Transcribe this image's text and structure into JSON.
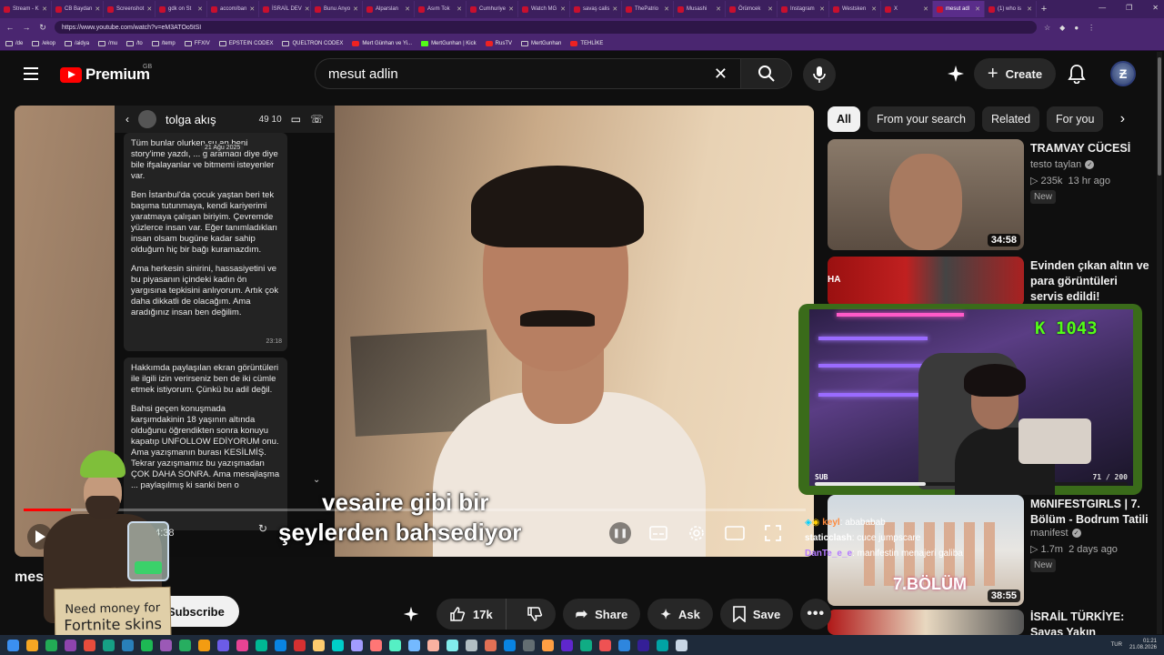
{
  "browser": {
    "tabs": [
      {
        "label": "Stream - K",
        "active": false
      },
      {
        "label": "CB Baydan",
        "active": false
      },
      {
        "label": "Screenshot",
        "active": false
      },
      {
        "label": "gdk on St",
        "active": false
      },
      {
        "label": "accom/ban",
        "active": false
      },
      {
        "label": "İSRAİL DEV",
        "active": false
      },
      {
        "label": "Bunu Anyo",
        "active": false
      },
      {
        "label": "Alparslan",
        "active": false
      },
      {
        "label": "Asım Tok",
        "active": false
      },
      {
        "label": "Cumhuriye",
        "active": false
      },
      {
        "label": "Watch MG",
        "active": false
      },
      {
        "label": "savaş calis",
        "active": false
      },
      {
        "label": "ThePatrio",
        "active": false
      },
      {
        "label": "Musashi",
        "active": false
      },
      {
        "label": "Örümcek",
        "active": false
      },
      {
        "label": "Instagram",
        "active": false
      },
      {
        "label": "Westsken",
        "active": false
      },
      {
        "label": "X",
        "active": false
      },
      {
        "label": "mesut adl",
        "active": true
      },
      {
        "label": "(1) who is",
        "active": false
      }
    ],
    "url": "https://www.youtube.com/watch?v=eM3ATOo5tSI",
    "bookmarks": [
      "/de",
      "/ekop",
      "/aidya",
      "/mu",
      "/to",
      "/temp",
      "FFXIV",
      "EPSTEIN CODEX",
      "QUELTRON CODEX",
      "Mert Günhan ve Yi...",
      "MertGunhan | Kick",
      "RusTV",
      "MertGunhan",
      "TEHLİKE"
    ]
  },
  "youtube": {
    "logo_text": "Premium",
    "region": "GB",
    "search_query": "mesut adlin",
    "create_label": "Create"
  },
  "video": {
    "chat_contact": "tolga akış",
    "chat_count": "49 10",
    "chat_date": "21 Ağu 2025",
    "bubble1": [
      "Tüm bunlar olurken şu an beni story'ime yazdı, ... g aramadı diye diye bile ifşalayanlar ve bitmemi isteyenler var.",
      "Ben İstanbul'da çocuk yaştan beri tek başıma tutunmaya, kendi kariyerimi yaratmaya çalışan biriyim. Çevremde yüzlerce insan var. Eğer tanımladıkları insan olsam bugüne kadar sahip olduğum hiç bir bağı kuramazdım.",
      "Ama herkesin sinirini, hassasiyetini ve bu piyasanın içindeki kadın ön yargısına tepkisini anlıyorum. Artık çok daha dikkatli de olacağım. Ama aradığınız insan ben değilim."
    ],
    "bubble1_time": "23:18",
    "bubble2": [
      "Hakkımda paylaşılan ekran görüntüleri ile ilgili izin verirseniz ben de iki cümle etmek istiyorum. Çünkü bu adil değil.",
      "Bahsi geçen konuşmada karşımdakinin 18 yaşının altında olduğunu öğrendikten sonra konuyu kapatıp UNFOLLOW EDİYORUM onu. Ama yazışmanın burası KESİLMİŞ. Tekrar yazışmamız bu yazışmadan ÇOK DAHA SONRA. Ama mesajlaşma ... paylaşılmış ki sanki ben o"
    ],
    "subtitle_line1": "vesaire gibi bir",
    "subtitle_line2": "şeylerden bahsediyor",
    "time": "14:38",
    "progress": 0.06,
    "title": "mes",
    "subscribe_label": "Subscribe",
    "likes": "17k",
    "share_label": "Share",
    "ask_label": "Ask",
    "save_label": "Save"
  },
  "overlay": {
    "sign_line1": "Need money for",
    "sign_line2": "Fortnite skins"
  },
  "sidebar": {
    "chips": [
      "All",
      "From your search",
      "Related",
      "For you"
    ],
    "recs": [
      {
        "title": "TRAMVAY CÜCESİ",
        "channel": "testo taylan",
        "views": "235k",
        "age": "13 hr ago",
        "badge": "New",
        "duration": "34:58"
      },
      {
        "title": "Evinden çıkan altın ve para görüntüleri servis edildi! Alparslan ...",
        "channel": "",
        "views": "",
        "age": "",
        "badge": "",
        "duration": ""
      },
      {
        "title": "M6NIFESTGIRLS | 7. Bölüm - Bodrum Tatili",
        "channel": "manifest",
        "views": "1.7m",
        "age": "2 days ago",
        "badge": "New",
        "duration": "38:55"
      },
      {
        "title": "İSRAİL TÜRKİYE: Savaş Yakın",
        "channel": "",
        "views": "",
        "age": "",
        "badge": "",
        "duration": ""
      }
    ],
    "thumb_text": "7.BÖLÜM",
    "thumb_left_text": "HA"
  },
  "stream": {
    "kick_count": "K 1043",
    "sub_label": "SUB",
    "sub_count": "71 / 200",
    "sub_progress": 0.355,
    "chat": [
      {
        "user": "keyl",
        "msg": "abababab"
      },
      {
        "user": "staticclash",
        "msg": "cuce jumpscare"
      },
      {
        "user": "DanTe_e_e",
        "msg": "manifestin menajeri galiba"
      }
    ]
  },
  "taskbar": {
    "lang": "TUR",
    "time": "01:21",
    "date": "21.08.2026"
  },
  "colors": {
    "browser_bg": "#3c1f5e",
    "yt_bg": "#0f0f0f",
    "accent_red": "#ff0000",
    "kick_green": "#53fc18"
  }
}
